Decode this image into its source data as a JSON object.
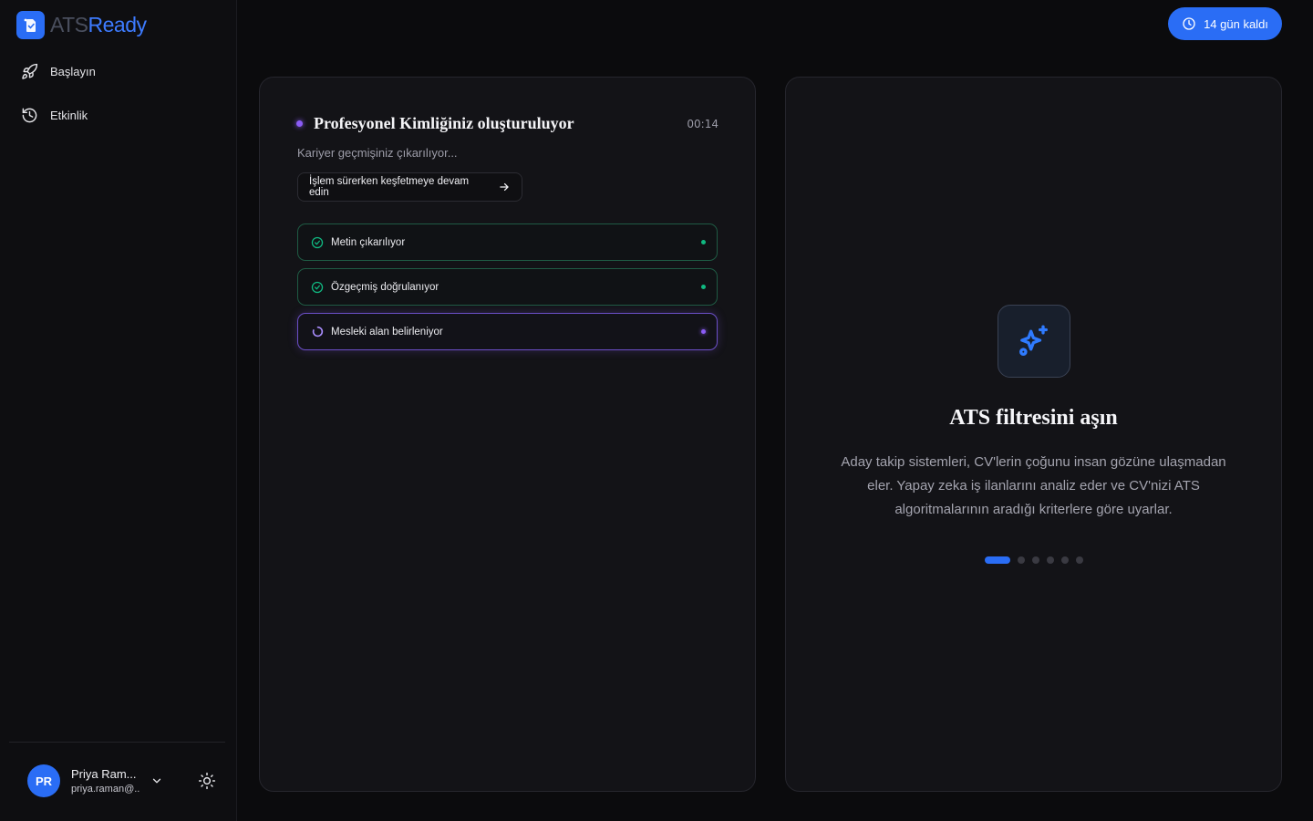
{
  "brand": {
    "ats": "ATS",
    "ready": "Ready"
  },
  "sidebar": {
    "items": [
      {
        "label": "Başlayın",
        "icon": "rocket-icon"
      },
      {
        "label": "Etkinlik",
        "icon": "history-icon"
      }
    ]
  },
  "user": {
    "initials": "PR",
    "name": "Priya Ram...",
    "email": "priya.raman@..."
  },
  "trial": {
    "label": "14 gün kaldı"
  },
  "progress": {
    "title": "Profesyonel Kimliğiniz oluşturuluyor",
    "timer": "00:14",
    "subtitle": "Kariyer geçmişiniz çıkarılıyor...",
    "explore_label": "İşlem sürerken keşfetmeye devam edin",
    "steps": [
      {
        "label": "Metin çıkarılıyor",
        "status": "done"
      },
      {
        "label": "Özgeçmiş doğrulanıyor",
        "status": "done"
      },
      {
        "label": "Mesleki alan belirleniyor",
        "status": "active"
      }
    ]
  },
  "feature": {
    "title": "ATS filtresini aşın",
    "description": "Aday takip sistemleri, CV'lerin çoğunu insan gözüne ulaşmadan eler. Yapay zeka iş ilanlarını analiz eder ve CV'nizi ATS algoritmalarının aradığı kriterlere göre uyarlar.",
    "slides_total": 6,
    "slide_active": 1
  },
  "colors": {
    "accent": "#2a6df5",
    "success": "#10b981",
    "active": "#8b5cf6"
  }
}
